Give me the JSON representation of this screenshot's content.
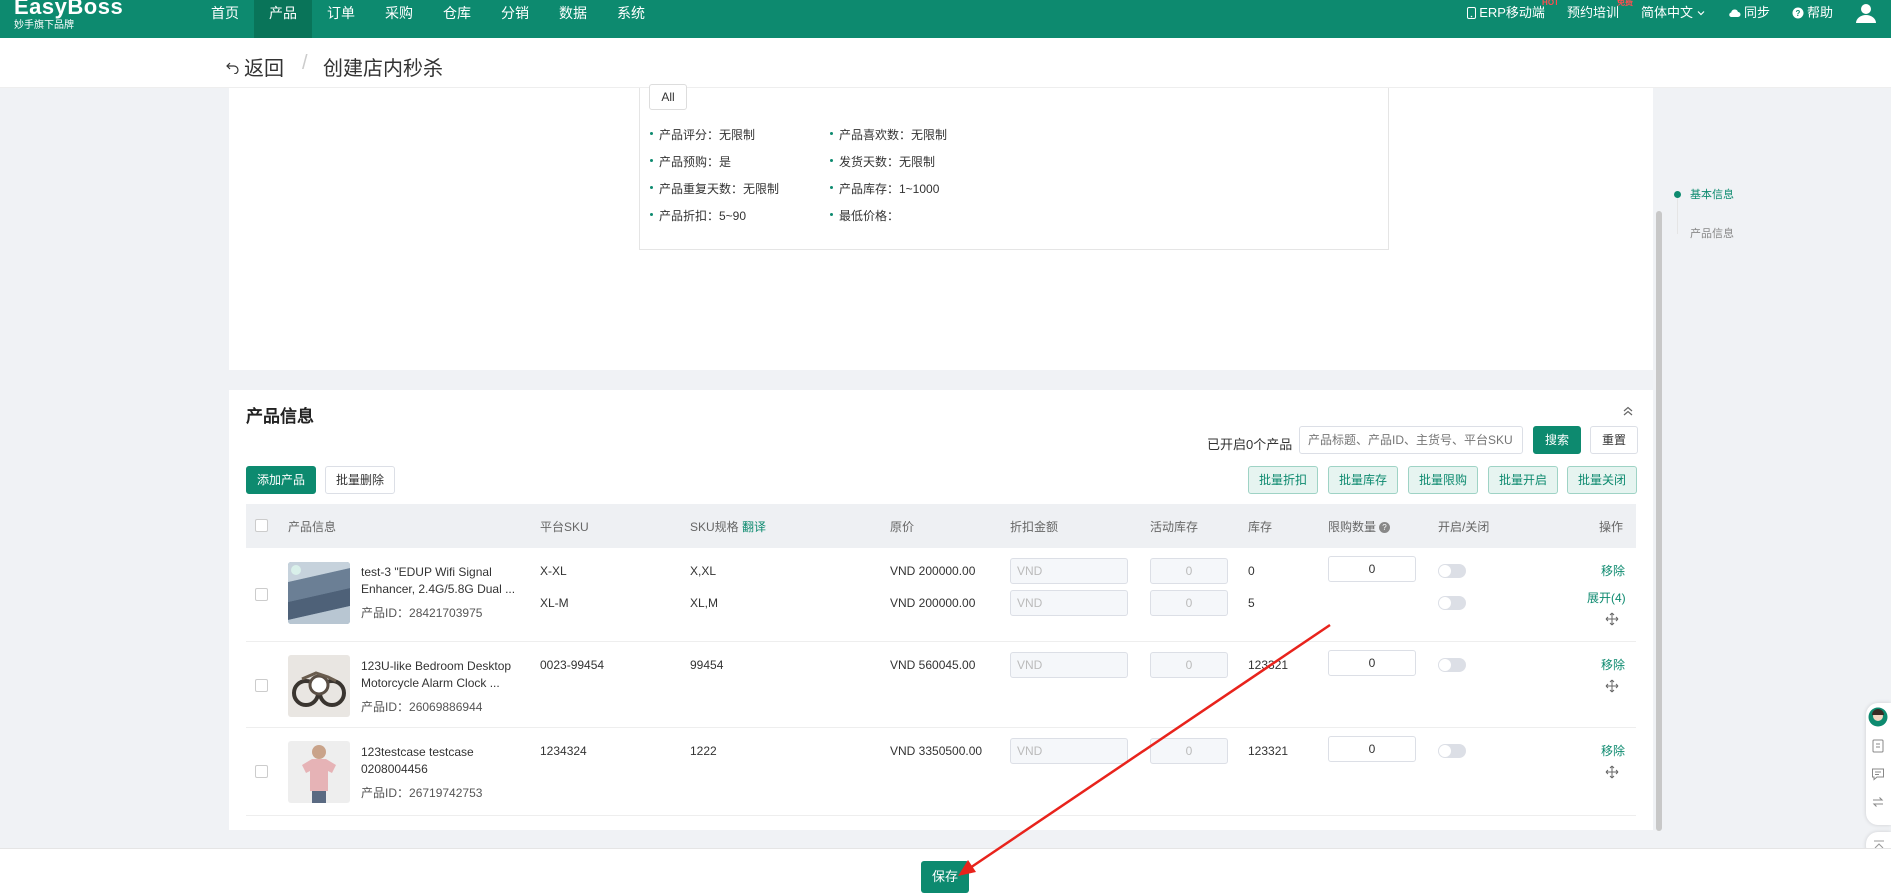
{
  "topnav": {
    "brand": "EasyBoss",
    "brand_sub": "妙手旗下品牌",
    "menu": [
      {
        "label": "首页"
      },
      {
        "label": "产品",
        "active": true
      },
      {
        "label": "订单"
      },
      {
        "label": "采购"
      },
      {
        "label": "仓库"
      },
      {
        "label": "分销"
      },
      {
        "label": "数据"
      },
      {
        "label": "系统"
      }
    ],
    "right": {
      "erp_mobile": "ERP移动端",
      "erp_badge": "HOT",
      "training": "预约培训",
      "training_badge": "免费",
      "language": "简体中文",
      "sync": "同步",
      "help": "帮助"
    }
  },
  "header": {
    "back": "返回",
    "separator": "/",
    "title": "创建店内秒杀"
  },
  "rules": {
    "all_button": "All",
    "items": [
      {
        "label": "产品评分：无限制"
      },
      {
        "label": "产品喜欢数：无限制"
      },
      {
        "label": "产品预购：是"
      },
      {
        "label": "发货天数：无限制"
      },
      {
        "label": "产品重复天数：无限制"
      },
      {
        "label": "产品库存：1~1000"
      },
      {
        "label": "产品折扣：5~90"
      },
      {
        "label": "最低价格："
      }
    ]
  },
  "anchor_nav": {
    "items": [
      {
        "label": "基本信息",
        "active": true
      },
      {
        "label": "产品信息"
      }
    ]
  },
  "product_section": {
    "title": "产品信息",
    "enabled_count": "已开启0个产品",
    "search_placeholder": "产品标题、产品ID、主货号、平台SKU",
    "search_button": "搜索",
    "reset_button": "重置",
    "add_button": "添加产品",
    "batch_delete_button": "批量删除",
    "batch_buttons": [
      "批量折扣",
      "批量库存",
      "批量限购",
      "批量开启",
      "批量关闭"
    ],
    "columns": {
      "info": "产品信息",
      "platform_sku": "平台SKU",
      "sku_spec": "SKU规格",
      "translate": "翻译",
      "price": "原价",
      "discount": "折扣金额",
      "activity_stock": "活动库存",
      "stock": "库存",
      "limit": "限购数量",
      "toggle": "开启/关闭",
      "action": "操作"
    },
    "rows": [
      {
        "title": "test-3 \"EDUP Wifi Signal Enhancer, 2.4G/5.8G Dual ...",
        "id_label": "产品ID：",
        "id": "28421703975",
        "skus": [
          {
            "platform_sku": "X-XL",
            "spec": "X,XL",
            "price": "VND 200000.00",
            "discount_ph": "VND",
            "activity_stock": "0",
            "stock": "0"
          },
          {
            "platform_sku": "XL-M",
            "spec": "XL,M",
            "price": "VND 200000.00",
            "discount_ph": "VND",
            "activity_stock": "0",
            "stock": "5"
          }
        ],
        "limit": "0",
        "remove": "移除",
        "expand": "展开(4)"
      },
      {
        "title": "123U-like Bedroom Desktop Motorcycle Alarm Clock ...",
        "id_label": "产品ID：",
        "id": "26069886944",
        "skus": [
          {
            "platform_sku": "0023-99454",
            "spec": "99454",
            "price": "VND 560045.00",
            "discount_ph": "VND",
            "activity_stock": "0",
            "stock": "123321"
          }
        ],
        "limit": "0",
        "remove": "移除"
      },
      {
        "title": "123testcase testcase 0208004456",
        "id_label": "产品ID：",
        "id": "26719742753",
        "skus": [
          {
            "platform_sku": "1234324",
            "spec": "1222",
            "price": "VND 3350500.00",
            "discount_ph": "VND",
            "activity_stock": "0",
            "stock": "123321"
          }
        ],
        "limit": "0",
        "remove": "移除"
      }
    ]
  },
  "footer": {
    "save_button": "保存"
  },
  "colors": {
    "primary": "#0d8a6f",
    "annotation_arrow": "#e8231c"
  }
}
